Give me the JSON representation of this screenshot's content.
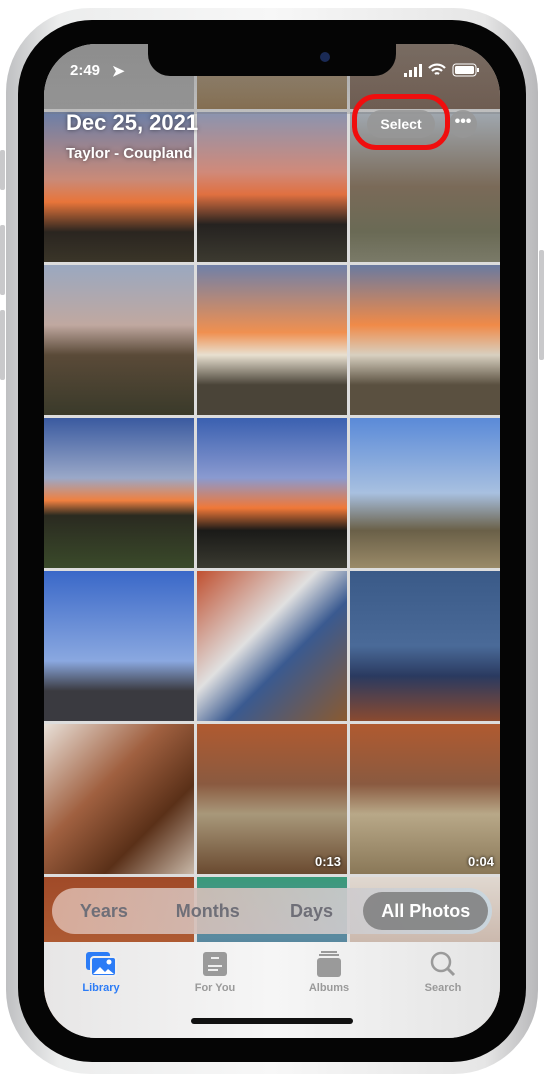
{
  "status": {
    "time": "2:49"
  },
  "header": {
    "date": "Dec 25, 2021",
    "location": "Taylor - Coupland",
    "select_label": "Select",
    "more_label": "•••"
  },
  "photos": [
    {
      "duration": ""
    },
    {
      "duration": ""
    },
    {
      "duration": ""
    },
    {
      "duration": ""
    },
    {
      "duration": ""
    },
    {
      "duration": ""
    },
    {
      "duration": ""
    },
    {
      "duration": ""
    },
    {
      "duration": ""
    },
    {
      "duration": ""
    },
    {
      "duration": ""
    },
    {
      "duration": ""
    },
    {
      "duration": ""
    },
    {
      "duration": "0:13"
    },
    {
      "duration": "0:04"
    },
    {
      "duration": ""
    },
    {
      "duration": ""
    },
    {
      "duration": ""
    }
  ],
  "segments": [
    "Years",
    "Months",
    "Days",
    "All Photos"
  ],
  "selected_segment": "All Photos",
  "tabs": [
    {
      "label": "Library",
      "icon": "photo-library-icon"
    },
    {
      "label": "For You",
      "icon": "for-you-icon"
    },
    {
      "label": "Albums",
      "icon": "albums-icon"
    },
    {
      "label": "Search",
      "icon": "search-icon"
    }
  ],
  "colors": {
    "accent": "#2c7cf6",
    "highlight_ring": "#f00e0e"
  }
}
